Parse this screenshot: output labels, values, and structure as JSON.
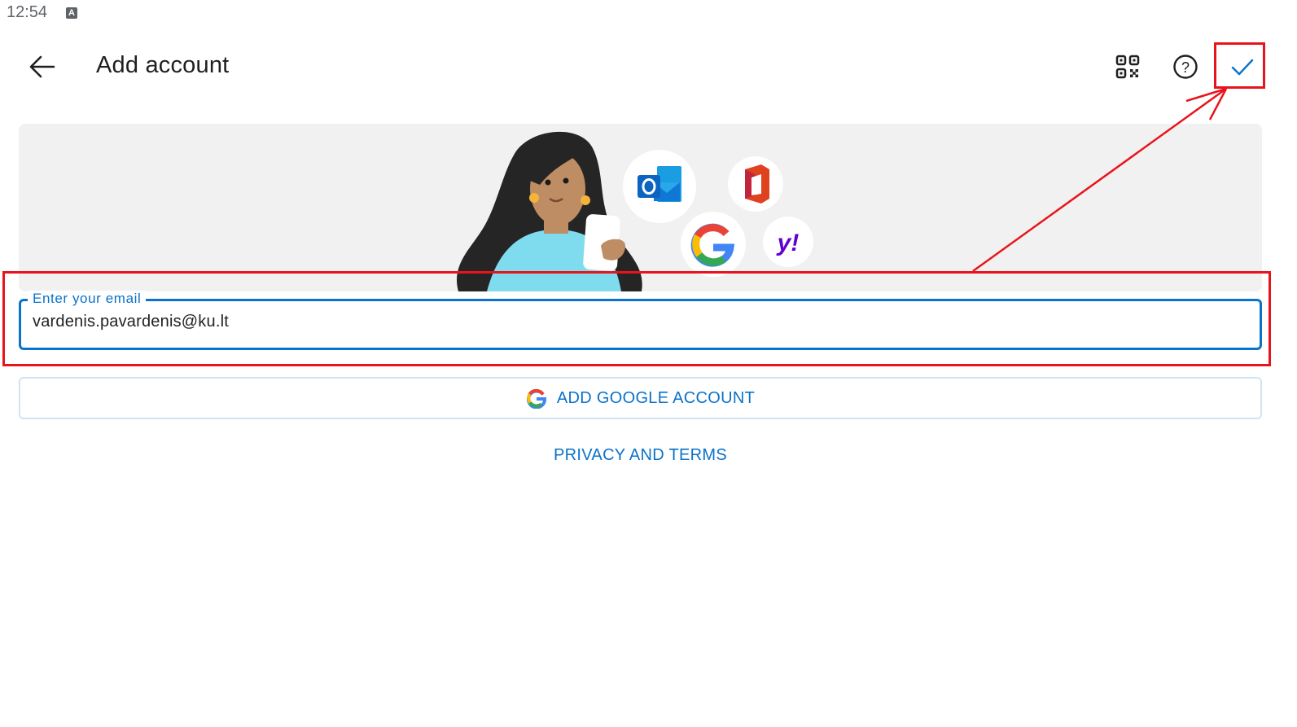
{
  "status_bar": {
    "time": "12:54",
    "notification_icon": "keyboard-a-icon",
    "notification_glyph": "A"
  },
  "app_bar": {
    "back_icon": "arrow-left-icon",
    "title": "Add account",
    "actions": [
      {
        "name": "qr-code-icon",
        "label": "Scan QR code"
      },
      {
        "name": "help-icon",
        "label": "Help"
      },
      {
        "name": "checkmark-icon",
        "label": "Continue"
      }
    ]
  },
  "banner": {
    "illustration": "woman holding phone",
    "provider_logos": [
      "outlook-logo",
      "office-logo",
      "google-logo",
      "yahoo-logo"
    ],
    "yahoo_text": "y!"
  },
  "email_field": {
    "label": "Enter your email",
    "value": "vardenis.pavardenis@ku.lt"
  },
  "google_button": {
    "icon": "google-g-icon",
    "label": "ADD GOOGLE ACCOUNT"
  },
  "privacy_link": {
    "label": "PRIVACY AND TERMS"
  },
  "colors": {
    "accent": "#0a72c9",
    "annotation": "#e8141c",
    "banner_bg": "#f1f1f1"
  }
}
